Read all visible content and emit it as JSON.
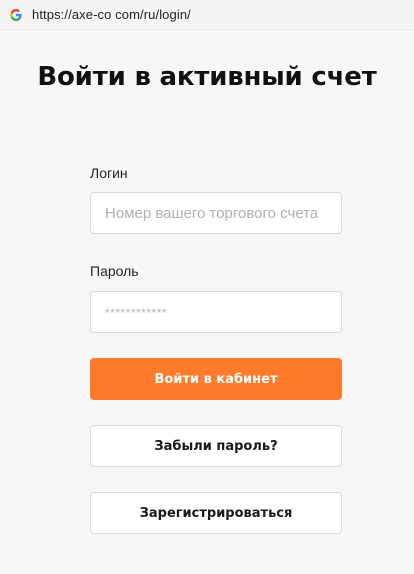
{
  "browser": {
    "url": "https://axe-co com/ru/login/",
    "favicon": "google-g-icon"
  },
  "page": {
    "title": "Войти в активный счет"
  },
  "form": {
    "login_label": "Логин",
    "login_placeholder": "Номер вашего торгового счета",
    "password_label": "Пароль",
    "password_placeholder": "************",
    "submit_label": "Войти в кабинет",
    "forgot_label": "Забыли пароль?",
    "register_label": "Зарегистрироваться"
  },
  "colors": {
    "accent": "#ff7a2b",
    "background": "#f7f7f7"
  }
}
